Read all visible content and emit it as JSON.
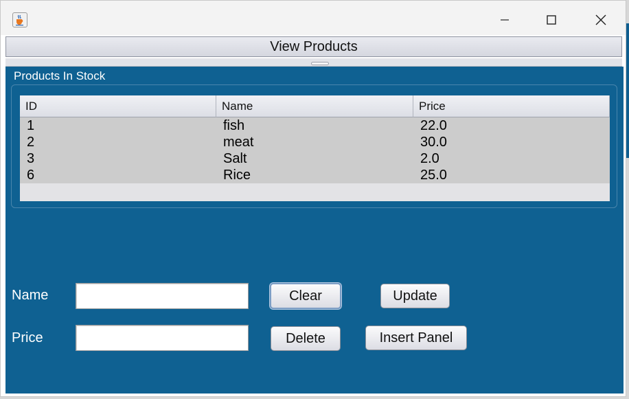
{
  "window": {
    "minimize_glyph": "—",
    "maximize_glyph": "☐",
    "close_glyph": "✕",
    "app_icon": "java-coffee-icon"
  },
  "header": {
    "button_label": "View Products"
  },
  "products_panel": {
    "title": "Products In Stock",
    "columns": [
      "ID",
      "Name",
      "Price"
    ],
    "rows": [
      [
        "1",
        "fish",
        "22.0"
      ],
      [
        "2",
        "meat",
        "30.0"
      ],
      [
        "3",
        "Salt",
        "2.0"
      ],
      [
        "6",
        "Rice",
        "25.0"
      ]
    ]
  },
  "form": {
    "name_label": "Name",
    "name_value": "",
    "price_label": "Price",
    "price_value": ""
  },
  "buttons": {
    "clear": "Clear",
    "update": "Update",
    "delete": "Delete",
    "insert_panel": "Insert Panel"
  },
  "colors": {
    "panel_background": "#0f6192",
    "table_rows": "#cccccc"
  }
}
